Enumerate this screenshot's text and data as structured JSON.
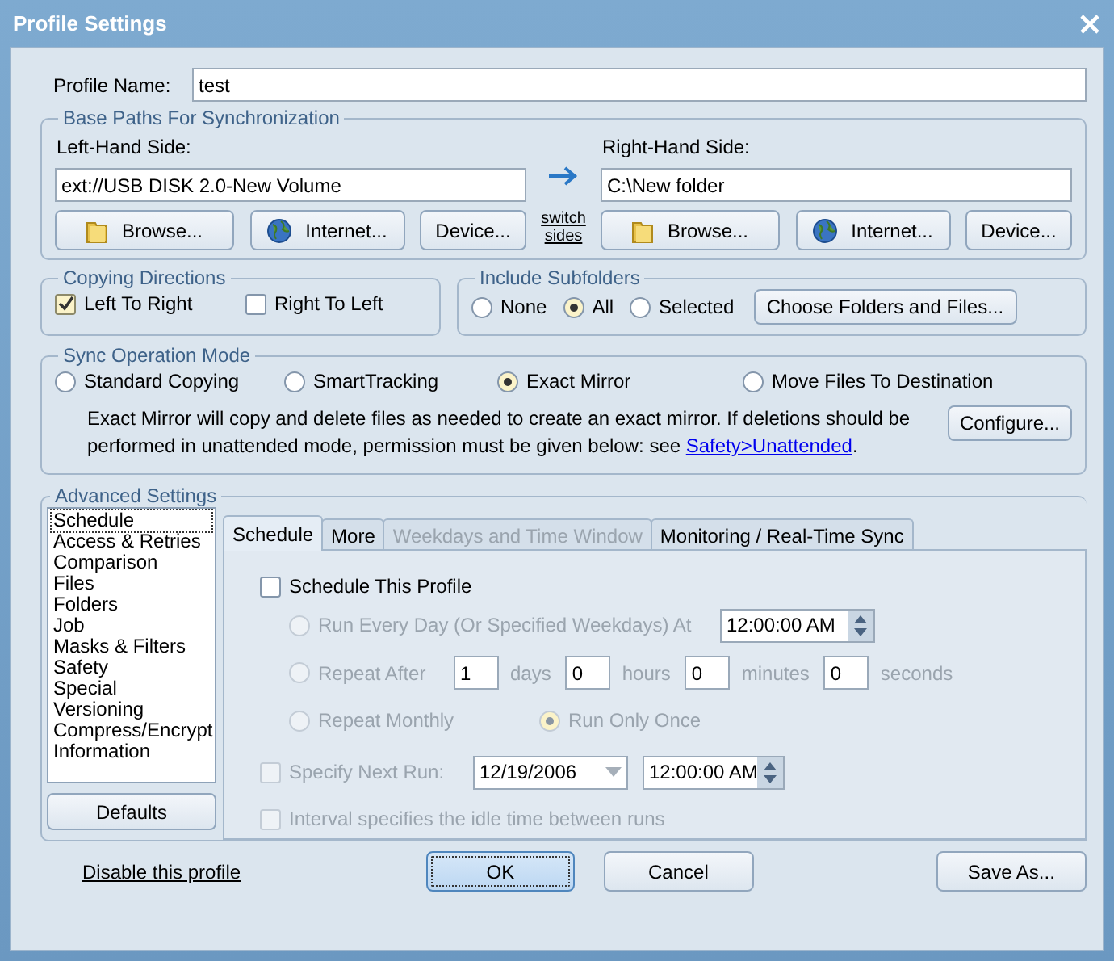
{
  "window": {
    "title": "Profile Settings"
  },
  "profile_name": {
    "label": "Profile Name:",
    "value": "test"
  },
  "base_paths": {
    "title": "Base Paths For Synchronization",
    "left": {
      "label": "Left-Hand Side:",
      "value": "ext://USB DISK 2.0-New Volume",
      "buttons": [
        {
          "kind": "browse",
          "label": "Browse..."
        },
        {
          "kind": "internet",
          "label": "Internet..."
        },
        {
          "kind": "device",
          "label": "Device..."
        }
      ]
    },
    "switch_link": "switch sides",
    "right": {
      "label": "Right-Hand Side:",
      "value": "C:\\New folder",
      "buttons": [
        {
          "kind": "browse",
          "label": "Browse..."
        },
        {
          "kind": "internet",
          "label": "Internet..."
        },
        {
          "kind": "device",
          "label": "Device..."
        }
      ]
    }
  },
  "copying_directions": {
    "title": "Copying Directions",
    "options": [
      {
        "label": "Left To Right",
        "checked": true
      },
      {
        "label": "Right To Left",
        "checked": false
      }
    ]
  },
  "include_subfolders": {
    "title": "Include Subfolders",
    "options": [
      {
        "label": "None",
        "selected": false
      },
      {
        "label": "All",
        "selected": true
      },
      {
        "label": "Selected",
        "selected": false
      }
    ],
    "button": "Choose Folders and Files..."
  },
  "sync_mode": {
    "title": "Sync Operation Mode",
    "options": [
      {
        "label": "Standard Copying",
        "selected": false
      },
      {
        "label": "SmartTracking",
        "selected": false
      },
      {
        "label": "Exact Mirror",
        "selected": true
      },
      {
        "label": "Move Files To Destination",
        "selected": false
      }
    ],
    "description": "Exact Mirror will copy and delete files as needed to create an exact mirror. If deletions should be performed in unattended mode, permission must be given below: see ",
    "link": "Safety>Unattended",
    "description_end": ".",
    "button": "Configure..."
  },
  "advanced": {
    "title": "Advanced Settings",
    "list": [
      {
        "label": "Schedule",
        "selected": true
      },
      {
        "label": "Access & Retries",
        "selected": false
      },
      {
        "label": "Comparison",
        "selected": false
      },
      {
        "label": "Files",
        "selected": false
      },
      {
        "label": "Folders",
        "selected": false
      },
      {
        "label": "Job",
        "selected": false
      },
      {
        "label": "Masks & Filters",
        "selected": false
      },
      {
        "label": "Safety",
        "selected": false
      },
      {
        "label": "Special",
        "selected": false
      },
      {
        "label": "Versioning",
        "selected": false
      },
      {
        "label": "Compress/Encrypt",
        "selected": false
      },
      {
        "label": "Information",
        "selected": false
      }
    ],
    "defaults_button": "Defaults",
    "tabs": [
      {
        "label": "Schedule",
        "selected": true,
        "disabled": false
      },
      {
        "label": "More",
        "selected": false,
        "disabled": false
      },
      {
        "label": "Weekdays and Time Window",
        "selected": false,
        "disabled": true
      },
      {
        "label": "Monitoring / Real-Time Sync",
        "selected": false,
        "disabled": false
      }
    ],
    "schedule": {
      "enable": {
        "label": "Schedule This Profile",
        "checked": false
      },
      "options": [
        {
          "kind": "daily",
          "label": "Run Every Day (Or Specified Weekdays) At",
          "selected": false,
          "disabled": true,
          "time": "12:00:00 AM"
        },
        {
          "kind": "repeat",
          "label": "Repeat After",
          "selected": false,
          "disabled": true,
          "fields": [
            {
              "value": "1",
              "unit": "days"
            },
            {
              "value": "0",
              "unit": "hours"
            },
            {
              "value": "0",
              "unit": "minutes"
            },
            {
              "value": "0",
              "unit": "seconds"
            }
          ]
        },
        {
          "kind": "monthly",
          "label": "Repeat Monthly",
          "selected": false,
          "disabled": true,
          "alt": {
            "label": "Run Only Once",
            "selected": true
          }
        }
      ],
      "next_run": {
        "label": "Specify Next Run:",
        "checked": false,
        "disabled": true,
        "date": "12/19/2006",
        "time": "12:00:00 AM"
      },
      "interval": {
        "label": "Interval specifies the idle time between runs",
        "checked": false,
        "disabled": true
      }
    }
  },
  "footer": {
    "link": "Disable this profile",
    "buttons": [
      {
        "label": "OK",
        "focused": true
      },
      {
        "label": "Cancel",
        "focused": false
      },
      {
        "label": "Save As...",
        "focused": false
      }
    ]
  }
}
